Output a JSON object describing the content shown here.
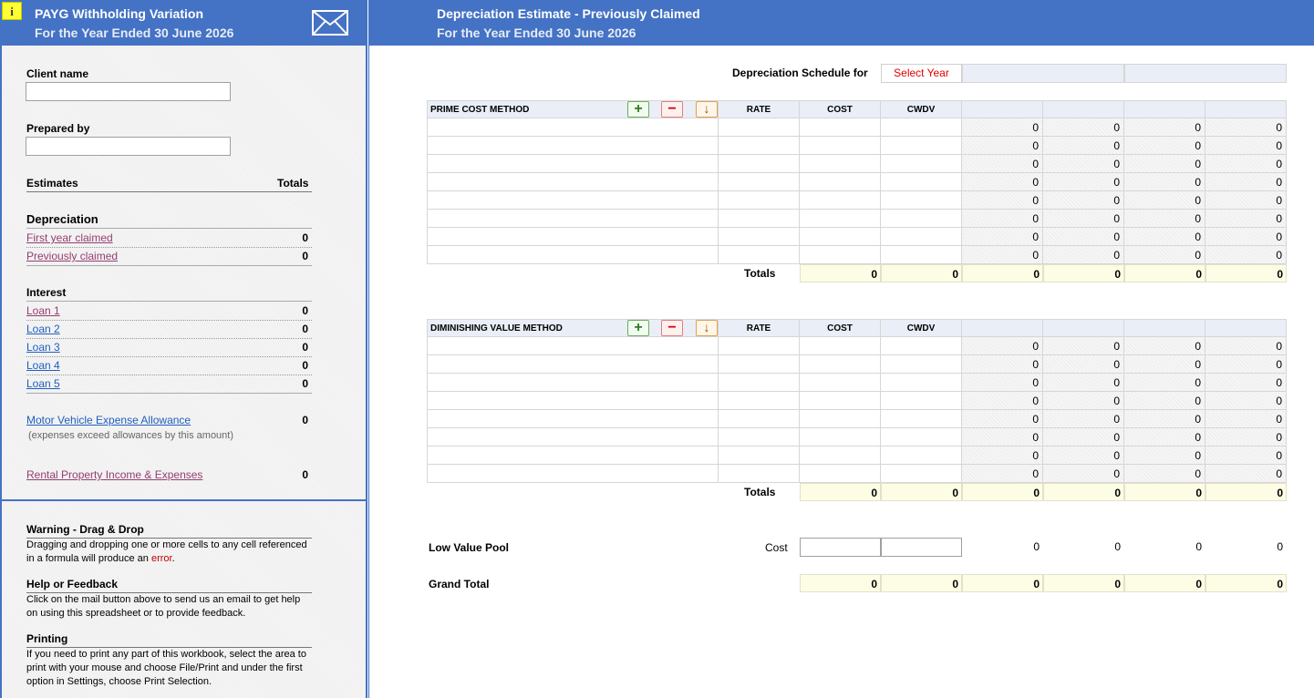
{
  "header": {
    "left_title": "PAYG Withholding Variation",
    "left_subtitle": "For the Year Ended 30 June 2026",
    "info_icon": "i",
    "right_title": "Depreciation Estimate - Previously Claimed",
    "right_subtitle": "For the Year Ended 30 June 2026"
  },
  "sidebar": {
    "client_name_label": "Client name",
    "client_name_value": "",
    "prepared_by_label": "Prepared by",
    "prepared_by_value": "",
    "estimates_label": "Estimates",
    "totals_label": "Totals",
    "depreciation_heading": "Depreciation",
    "depreciation_items": [
      {
        "label": "First year claimed",
        "value": "0"
      },
      {
        "label": "Previously claimed",
        "value": "0"
      }
    ],
    "interest_heading": "Interest",
    "interest_items": [
      {
        "label": "Loan 1",
        "value": "0"
      },
      {
        "label": "Loan 2",
        "value": "0"
      },
      {
        "label": "Loan 3",
        "value": "0"
      },
      {
        "label": "Loan 4",
        "value": "0"
      },
      {
        "label": "Loan 5",
        "value": "0"
      }
    ],
    "motor_vehicle_label": "Motor Vehicle Expense Allowance",
    "motor_vehicle_value": "0",
    "motor_vehicle_note": "(expenses exceed allowances by this amount)",
    "rental_label": "Rental Property Income & Expenses",
    "rental_value": "0",
    "warning_heading": "Warning - Drag & Drop",
    "warning_text_1": "Dragging and dropping one or more cells to any cell referenced in a formula will produce an ",
    "warning_text_err": "error",
    "warning_text_2": ".",
    "help_heading": "Help or Feedback",
    "help_text": "Click on the mail button above to send us an email to get help on using this spreadsheet or to provide feedback.",
    "printing_heading": "Printing",
    "printing_text": "If you need to print any part of this workbook, select the area to print with your mouse and choose File/Print and under the first option in Settings, choose Print Selection."
  },
  "main": {
    "schedule_label": "Depreciation Schedule for",
    "select_year": "Select Year",
    "columns": {
      "rate": "RATE",
      "cost": "COST",
      "cwdv": "CWDV"
    },
    "prime_cost": {
      "title": "PRIME COST METHOD",
      "rows": [
        [
          "0",
          "0",
          "0",
          "0"
        ],
        [
          "0",
          "0",
          "0",
          "0"
        ],
        [
          "0",
          "0",
          "0",
          "0"
        ],
        [
          "0",
          "0",
          "0",
          "0"
        ],
        [
          "0",
          "0",
          "0",
          "0"
        ],
        [
          "0",
          "0",
          "0",
          "0"
        ],
        [
          "0",
          "0",
          "0",
          "0"
        ],
        [
          "0",
          "0",
          "0",
          "0"
        ]
      ],
      "totals_label": "Totals",
      "totals": [
        "0",
        "0",
        "0",
        "0",
        "0",
        "0"
      ]
    },
    "diminishing": {
      "title": "DIMINISHING VALUE METHOD",
      "rows": [
        [
          "0",
          "0",
          "0",
          "0"
        ],
        [
          "0",
          "0",
          "0",
          "0"
        ],
        [
          "0",
          "0",
          "0",
          "0"
        ],
        [
          "0",
          "0",
          "0",
          "0"
        ],
        [
          "0",
          "0",
          "0",
          "0"
        ],
        [
          "0",
          "0",
          "0",
          "0"
        ],
        [
          "0",
          "0",
          "0",
          "0"
        ],
        [
          "0",
          "0",
          "0",
          "0"
        ]
      ],
      "totals_label": "Totals",
      "totals": [
        "0",
        "0",
        "0",
        "0",
        "0",
        "0"
      ]
    },
    "low_value_pool": {
      "label": "Low Value Pool",
      "cost_label": "Cost",
      "values": [
        "0",
        "0",
        "0",
        "0"
      ]
    },
    "grand_total": {
      "label": "Grand Total",
      "values": [
        "0",
        "0",
        "0",
        "0",
        "0",
        "0"
      ]
    },
    "buttons": {
      "add": "+",
      "remove": "−",
      "down": "↓"
    }
  },
  "colors": {
    "header_blue": "#4472c4",
    "link_purple": "#953d70",
    "link_blue": "#1f5fbf",
    "select_year_red": "#e00000",
    "totals_fill": "#fdfde6"
  }
}
